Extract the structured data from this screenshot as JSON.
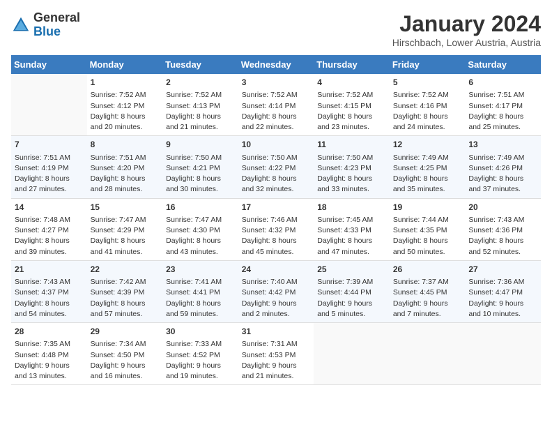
{
  "header": {
    "logo_general": "General",
    "logo_blue": "Blue",
    "title": "January 2024",
    "location": "Hirschbach, Lower Austria, Austria"
  },
  "days_of_week": [
    "Sunday",
    "Monday",
    "Tuesday",
    "Wednesday",
    "Thursday",
    "Friday",
    "Saturday"
  ],
  "weeks": [
    [
      {
        "num": "",
        "info": ""
      },
      {
        "num": "1",
        "info": "Sunrise: 7:52 AM\nSunset: 4:12 PM\nDaylight: 8 hours\nand 20 minutes."
      },
      {
        "num": "2",
        "info": "Sunrise: 7:52 AM\nSunset: 4:13 PM\nDaylight: 8 hours\nand 21 minutes."
      },
      {
        "num": "3",
        "info": "Sunrise: 7:52 AM\nSunset: 4:14 PM\nDaylight: 8 hours\nand 22 minutes."
      },
      {
        "num": "4",
        "info": "Sunrise: 7:52 AM\nSunset: 4:15 PM\nDaylight: 8 hours\nand 23 minutes."
      },
      {
        "num": "5",
        "info": "Sunrise: 7:52 AM\nSunset: 4:16 PM\nDaylight: 8 hours\nand 24 minutes."
      },
      {
        "num": "6",
        "info": "Sunrise: 7:51 AM\nSunset: 4:17 PM\nDaylight: 8 hours\nand 25 minutes."
      }
    ],
    [
      {
        "num": "7",
        "info": "Sunrise: 7:51 AM\nSunset: 4:19 PM\nDaylight: 8 hours\nand 27 minutes."
      },
      {
        "num": "8",
        "info": "Sunrise: 7:51 AM\nSunset: 4:20 PM\nDaylight: 8 hours\nand 28 minutes."
      },
      {
        "num": "9",
        "info": "Sunrise: 7:50 AM\nSunset: 4:21 PM\nDaylight: 8 hours\nand 30 minutes."
      },
      {
        "num": "10",
        "info": "Sunrise: 7:50 AM\nSunset: 4:22 PM\nDaylight: 8 hours\nand 32 minutes."
      },
      {
        "num": "11",
        "info": "Sunrise: 7:50 AM\nSunset: 4:23 PM\nDaylight: 8 hours\nand 33 minutes."
      },
      {
        "num": "12",
        "info": "Sunrise: 7:49 AM\nSunset: 4:25 PM\nDaylight: 8 hours\nand 35 minutes."
      },
      {
        "num": "13",
        "info": "Sunrise: 7:49 AM\nSunset: 4:26 PM\nDaylight: 8 hours\nand 37 minutes."
      }
    ],
    [
      {
        "num": "14",
        "info": "Sunrise: 7:48 AM\nSunset: 4:27 PM\nDaylight: 8 hours\nand 39 minutes."
      },
      {
        "num": "15",
        "info": "Sunrise: 7:47 AM\nSunset: 4:29 PM\nDaylight: 8 hours\nand 41 minutes."
      },
      {
        "num": "16",
        "info": "Sunrise: 7:47 AM\nSunset: 4:30 PM\nDaylight: 8 hours\nand 43 minutes."
      },
      {
        "num": "17",
        "info": "Sunrise: 7:46 AM\nSunset: 4:32 PM\nDaylight: 8 hours\nand 45 minutes."
      },
      {
        "num": "18",
        "info": "Sunrise: 7:45 AM\nSunset: 4:33 PM\nDaylight: 8 hours\nand 47 minutes."
      },
      {
        "num": "19",
        "info": "Sunrise: 7:44 AM\nSunset: 4:35 PM\nDaylight: 8 hours\nand 50 minutes."
      },
      {
        "num": "20",
        "info": "Sunrise: 7:43 AM\nSunset: 4:36 PM\nDaylight: 8 hours\nand 52 minutes."
      }
    ],
    [
      {
        "num": "21",
        "info": "Sunrise: 7:43 AM\nSunset: 4:37 PM\nDaylight: 8 hours\nand 54 minutes."
      },
      {
        "num": "22",
        "info": "Sunrise: 7:42 AM\nSunset: 4:39 PM\nDaylight: 8 hours\nand 57 minutes."
      },
      {
        "num": "23",
        "info": "Sunrise: 7:41 AM\nSunset: 4:41 PM\nDaylight: 8 hours\nand 59 minutes."
      },
      {
        "num": "24",
        "info": "Sunrise: 7:40 AM\nSunset: 4:42 PM\nDaylight: 9 hours\nand 2 minutes."
      },
      {
        "num": "25",
        "info": "Sunrise: 7:39 AM\nSunset: 4:44 PM\nDaylight: 9 hours\nand 5 minutes."
      },
      {
        "num": "26",
        "info": "Sunrise: 7:37 AM\nSunset: 4:45 PM\nDaylight: 9 hours\nand 7 minutes."
      },
      {
        "num": "27",
        "info": "Sunrise: 7:36 AM\nSunset: 4:47 PM\nDaylight: 9 hours\nand 10 minutes."
      }
    ],
    [
      {
        "num": "28",
        "info": "Sunrise: 7:35 AM\nSunset: 4:48 PM\nDaylight: 9 hours\nand 13 minutes."
      },
      {
        "num": "29",
        "info": "Sunrise: 7:34 AM\nSunset: 4:50 PM\nDaylight: 9 hours\nand 16 minutes."
      },
      {
        "num": "30",
        "info": "Sunrise: 7:33 AM\nSunset: 4:52 PM\nDaylight: 9 hours\nand 19 minutes."
      },
      {
        "num": "31",
        "info": "Sunrise: 7:31 AM\nSunset: 4:53 PM\nDaylight: 9 hours\nand 21 minutes."
      },
      {
        "num": "",
        "info": ""
      },
      {
        "num": "",
        "info": ""
      },
      {
        "num": "",
        "info": ""
      }
    ]
  ]
}
